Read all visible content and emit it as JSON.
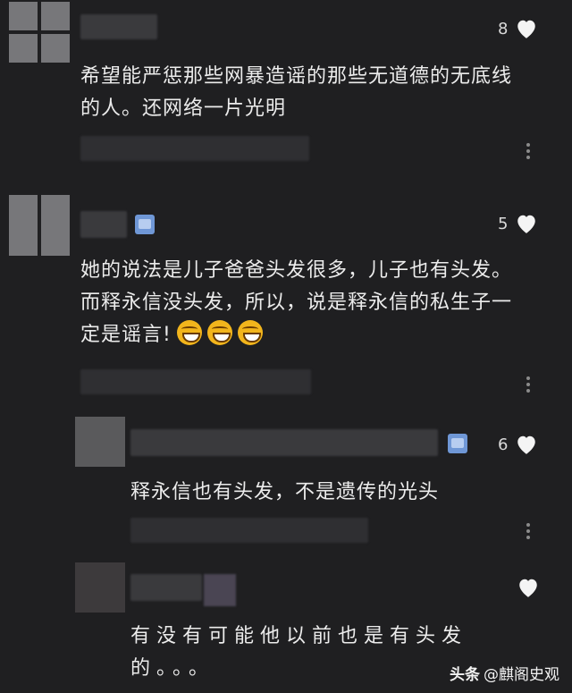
{
  "comments": [
    {
      "likes": "8",
      "text": "希望能严惩那些网暴造谣的那些无道德的无底线的人。还网络一片光明"
    },
    {
      "likes": "5",
      "text": "她的说法是儿子爸爸头发很多，儿子也有头发。而释永信没头发，所以，说是释永信的私生子一定是谣言!"
    },
    {
      "likes": "6",
      "text": "释永信也有头发，不是遗传的光头"
    },
    {
      "likes": "",
      "text": "有没有可能他以前也是有头发的。。。"
    }
  ],
  "watermark": {
    "brand": "头条",
    "author": "@麒阁史观"
  },
  "colors": {
    "background": "#1f1f21",
    "text": "#ececec",
    "badge": "#6f97d6",
    "emoji": "#f2b51c"
  },
  "icons": [
    "heart-icon",
    "more-icon",
    "level-badge-icon",
    "grin-emoji-icon"
  ]
}
